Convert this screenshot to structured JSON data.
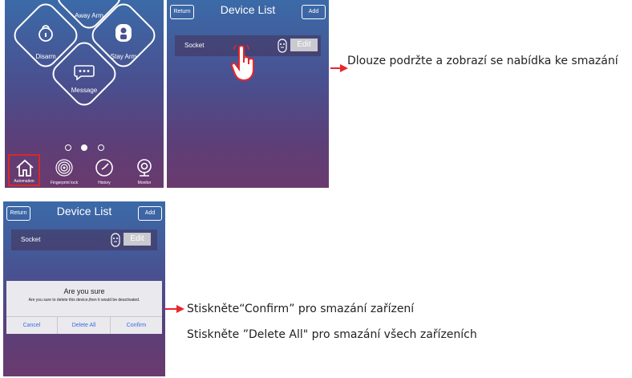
{
  "panel1": {
    "away_arm": "Away Arm",
    "disarm": "Disarm",
    "stay_arm": "Stay Arm",
    "message": "Message",
    "nav": [
      "Automation",
      "Fingerprint lock",
      "History",
      "Monitor"
    ]
  },
  "panel2": {
    "return_label": "Return",
    "title": "Device  List",
    "add_label": "Add",
    "device_name": "Socket",
    "edit_label": "Edit"
  },
  "panel3": {
    "return_label": "Return",
    "title": "Device  List",
    "add_label": "Add",
    "device_name": "Socket",
    "edit_label": "Edit",
    "dialog": {
      "title": "Are you sure",
      "message": "Are you sure to delete this device,then it would be deactivated.",
      "cancel": "Cancel",
      "delete_all": "Delete  All",
      "confirm": "Confirm"
    }
  },
  "annotations": {
    "long_press": "Dlouze podržte a zobrazí se nabídka ke smazání",
    "confirm_note": "Stiskněte“Confirm”  pro smazání zařízení",
    "delete_all_note": "Stiskněte  ”Delete All\" pro smazání všech zařízeních"
  },
  "colors": {
    "arrow": "#e8262b",
    "highlight_box": "#d42a2a"
  }
}
